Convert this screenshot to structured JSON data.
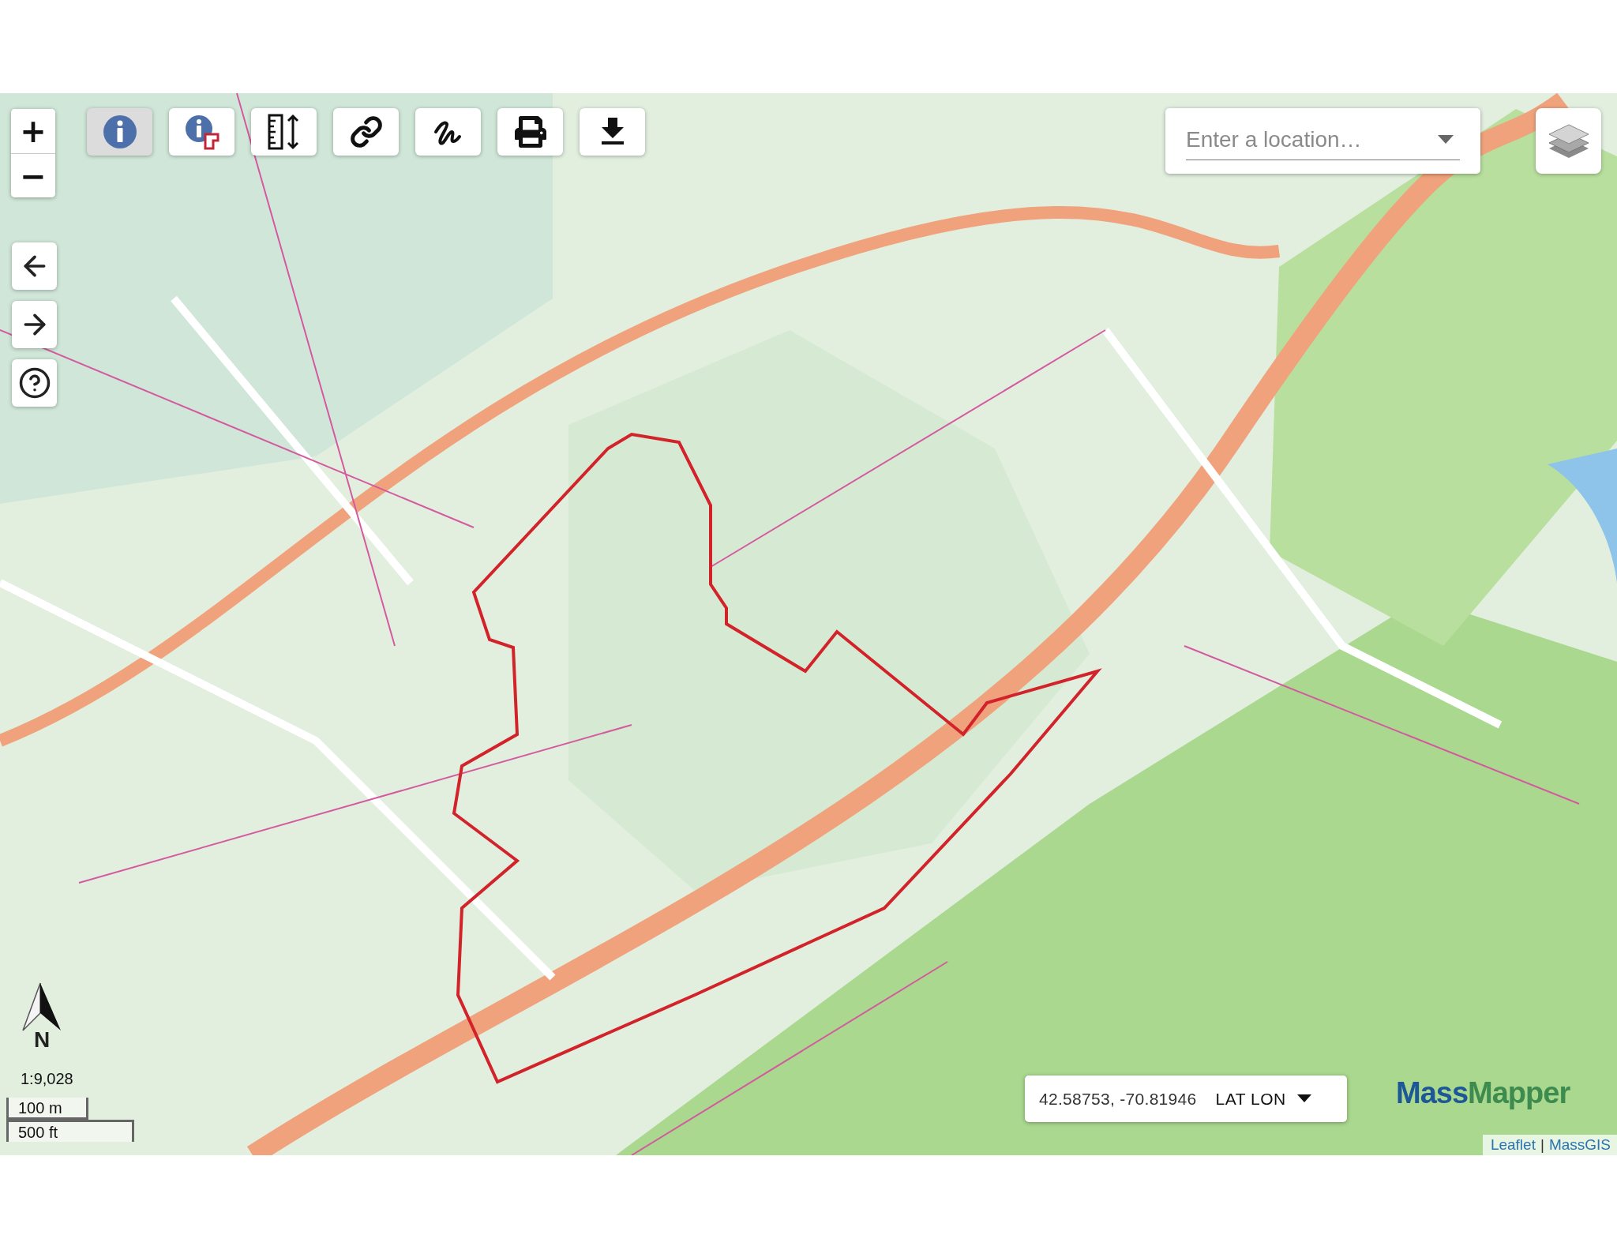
{
  "zoom": {
    "in": "+",
    "out": "−"
  },
  "toolbar": [
    {
      "kind": "identify",
      "selected": true
    },
    {
      "kind": "identify-area",
      "selected": false
    },
    {
      "kind": "measure",
      "selected": false
    },
    {
      "kind": "link",
      "selected": false
    },
    {
      "kind": "draw",
      "selected": false
    },
    {
      "kind": "print",
      "selected": false
    },
    {
      "kind": "download",
      "selected": false
    }
  ],
  "search": {
    "placeholder": "Enter a location…"
  },
  "north": {
    "label": "N"
  },
  "scale": {
    "ratio": "1:9,028",
    "metric": "100 m",
    "imperial": "500 ft"
  },
  "coordinates": {
    "value": "42.58753, -70.81946",
    "format": "LAT LON"
  },
  "logo": {
    "parts": [
      {
        "text": "Mass",
        "color": "#1d5797"
      },
      {
        "text": "Mapper",
        "color": "#3d8b4e"
      }
    ]
  },
  "attribution": {
    "links": [
      "Leaflet",
      "MassGIS"
    ],
    "separator": "|"
  }
}
